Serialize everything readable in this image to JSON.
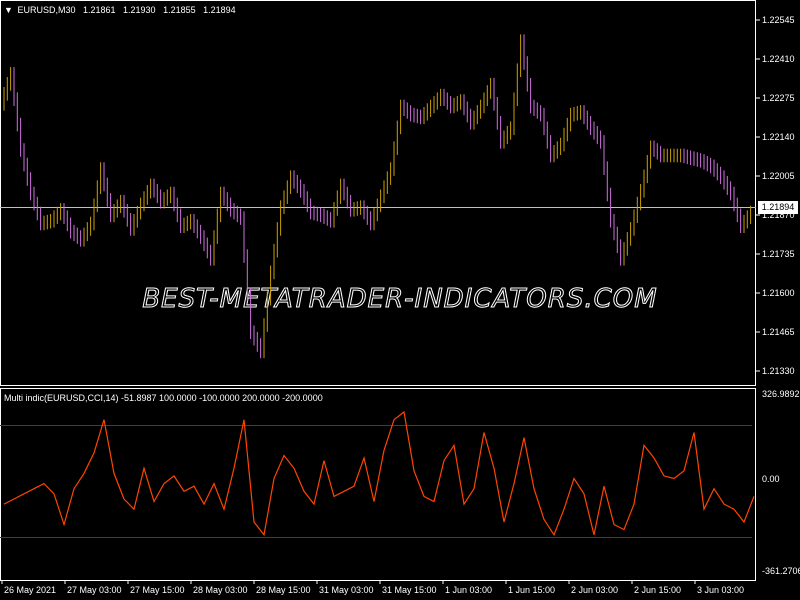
{
  "symbol_header": {
    "arrow": "▼",
    "symbol": "EURUSD,M30",
    "open": "1.21861",
    "high": "1.21930",
    "low": "1.21855",
    "close": "1.21894"
  },
  "price_axis": {
    "ticks": [
      "1.22545",
      "1.22410",
      "1.22275",
      "1.22140",
      "1.22005",
      "1.21870",
      "1.21735",
      "1.21600",
      "1.21465",
      "1.21330"
    ],
    "current_price_label": "1.21894"
  },
  "watermark": "BEST-METATRADER-INDICATORS.COM",
  "indicator": {
    "header": "Multi indic(EURUSD,CCI,14) -51.8987 100.0000 -100.0000 200.0000 -200.0000",
    "ticks": [
      "326.9892",
      "0.00",
      "-361.2706"
    ]
  },
  "time_axis": {
    "labels": [
      "26 May 2021",
      "27 May 03:00",
      "27 May 15:00",
      "28 May 03:00",
      "28 May 15:00",
      "31 May 03:00",
      "31 May 15:00",
      "1 Jun 03:00",
      "1 Jun 15:00",
      "2 Jun 03:00",
      "2 Jun 15:00",
      "3 Jun 03:00"
    ]
  },
  "colors": {
    "background": "#000000",
    "up_candle": "#c8a000",
    "down_candle": "#d070e0",
    "cci_line": "#ff4500",
    "level_lines": "#d00000",
    "axis_text": "#ffffff",
    "grid_line": "#c0c0c0"
  },
  "chart_data": [
    {
      "type": "line",
      "title": "EURUSD,M30",
      "ylim": [
        1.2126,
        1.2262
      ],
      "x": [
        0,
        10,
        20,
        30,
        40,
        50,
        60,
        70,
        80,
        90,
        100,
        110,
        120,
        130,
        140,
        150,
        160,
        170,
        180,
        190,
        200,
        210,
        220,
        230,
        240,
        250,
        260,
        270,
        280,
        290,
        300,
        310,
        320,
        330,
        340,
        350,
        360,
        370,
        380,
        390,
        400,
        410,
        420,
        430,
        440,
        450,
        460,
        470,
        480,
        490,
        500,
        510,
        520,
        530,
        540,
        550,
        560,
        570,
        580,
        590,
        600,
        610,
        620,
        630,
        640,
        650,
        660,
        670,
        680,
        690,
        700,
        710,
        720,
        730,
        740,
        750
      ],
      "values": [
        1.2229,
        1.224,
        1.2212,
        1.2196,
        1.2185,
        1.2186,
        1.219,
        1.2182,
        1.2179,
        1.2185,
        1.2205,
        1.2188,
        1.2193,
        1.2183,
        1.2192,
        1.2199,
        1.2193,
        1.2196,
        1.2184,
        1.2186,
        1.218,
        1.2172,
        1.2196,
        1.219,
        1.2187,
        1.2145,
        1.2138,
        1.2167,
        1.2191,
        1.2202,
        1.2197,
        1.2189,
        1.2188,
        1.2186,
        1.2199,
        1.219,
        1.2191,
        1.2185,
        1.2195,
        1.2205,
        1.2228,
        1.2225,
        1.2224,
        1.2228,
        1.2232,
        1.2228,
        1.223,
        1.2222,
        1.2228,
        1.2236,
        1.2215,
        1.222,
        1.2252,
        1.2228,
        1.2225,
        1.221,
        1.2214,
        1.2225,
        1.2226,
        1.222,
        1.2215,
        1.2186,
        1.2172,
        1.2183,
        1.2197,
        1.2213,
        1.221,
        1.221,
        1.221,
        1.2209,
        1.2208,
        1.2206,
        1.2202,
        1.2196,
        1.2184,
        1.2189
      ]
    },
    {
      "type": "line",
      "title": "Multi indic(EURUSD,CCI,14)",
      "ylim": [
        -361.2706,
        326.9892
      ],
      "levels": [
        100,
        -100,
        200,
        -200
      ],
      "x": [
        0,
        10,
        20,
        30,
        40,
        50,
        60,
        70,
        80,
        90,
        100,
        110,
        120,
        130,
        140,
        150,
        160,
        170,
        180,
        190,
        200,
        210,
        220,
        230,
        240,
        250,
        260,
        270,
        280,
        290,
        300,
        310,
        320,
        330,
        340,
        350,
        360,
        370,
        380,
        390,
        400,
        410,
        420,
        430,
        440,
        450,
        460,
        470,
        480,
        490,
        500,
        510,
        520,
        530,
        540,
        550,
        560,
        570,
        580,
        590,
        600,
        610,
        620,
        630,
        640,
        650,
        660,
        670,
        680,
        690,
        700,
        710,
        720,
        730,
        740,
        750
      ],
      "values": [
        -80,
        -60,
        -40,
        -20,
        0,
        -40,
        -160,
        -20,
        40,
        120,
        250,
        40,
        -60,
        -100,
        60,
        -70,
        0,
        30,
        -30,
        -10,
        -80,
        0,
        -100,
        60,
        250,
        -150,
        -200,
        20,
        110,
        60,
        -30,
        -80,
        90,
        -50,
        -30,
        -10,
        100,
        -70,
        130,
        250,
        280,
        50,
        -50,
        -70,
        90,
        150,
        -80,
        -20,
        200,
        60,
        -150,
        0,
        180,
        -20,
        -140,
        -200,
        -100,
        20,
        -40,
        -200,
        -10,
        -160,
        -180,
        -80,
        150,
        100,
        30,
        20,
        50,
        200,
        -100,
        -20,
        -80,
        -100,
        -150,
        -50
      ]
    }
  ]
}
